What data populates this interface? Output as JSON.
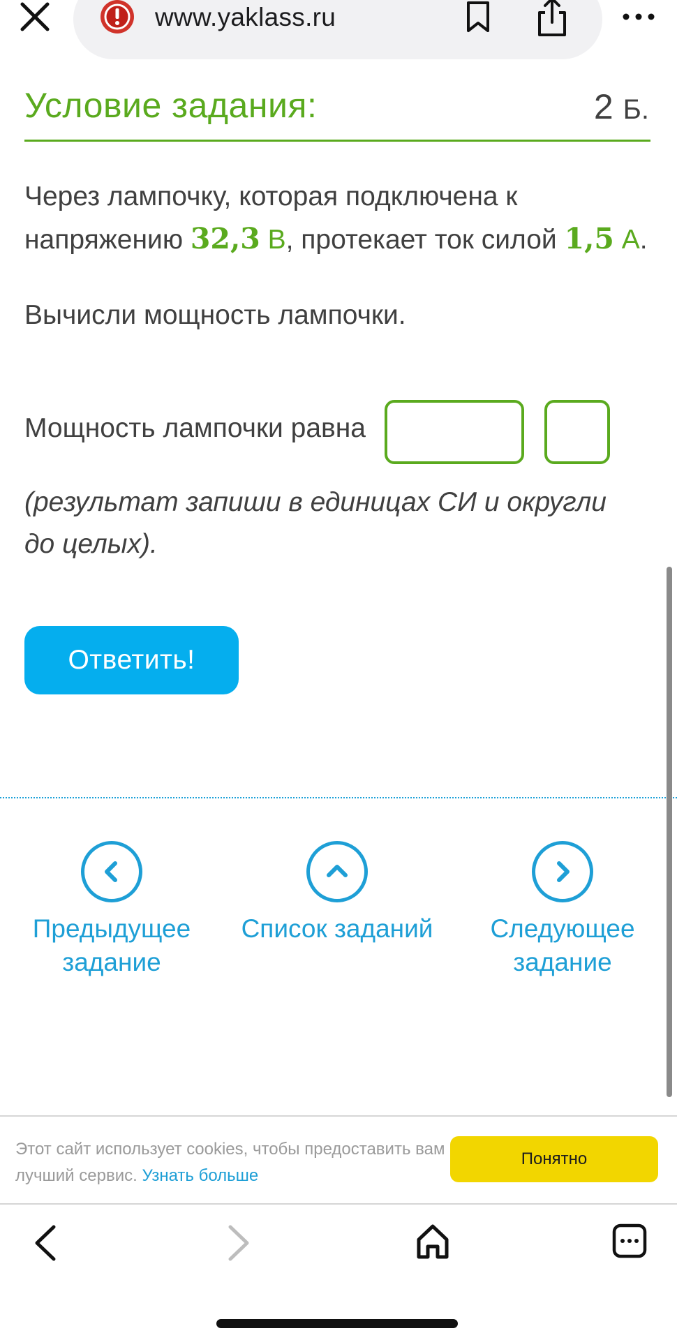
{
  "browser": {
    "url": "www.yaklass.ru"
  },
  "task": {
    "title": "Условие задания:",
    "points_value": "2",
    "points_unit": "Б.",
    "line1": "Через лампочку, которая подключена к",
    "line2_a": "напряжению ",
    "voltage": "32,3",
    "voltage_unit": " В",
    "line2_b": ", протекает ток силой ",
    "current": "1,5",
    "current_unit": " А",
    "line2_c": ".",
    "question": "Вычисли мощность лампочки.",
    "answer_label": "Мощность лампочки равна",
    "answer_value": "",
    "unit_value": "",
    "hint": " (результат запиши в единицах СИ и округли до целых).",
    "submit_label": "Ответить!"
  },
  "nav": {
    "prev_label_1": "Предыдущее",
    "prev_label_2": "задание",
    "list_label": "Список заданий",
    "next_label_1": "Следующее",
    "next_label_2": "задание"
  },
  "cookie": {
    "text": "Этот сайт использует cookies, чтобы предоставить вам лучший сервис. ",
    "link": "Узнать больше",
    "button": "Понятно"
  },
  "colors": {
    "accent_green": "#5aaa1e",
    "link_blue": "#1e9fd6",
    "button_blue": "#05aeee",
    "cookie_yellow": "#f2d600"
  },
  "icons": [
    "close-icon",
    "warning-icon",
    "bookmark-icon",
    "share-icon",
    "more-icon",
    "chevron-left-icon",
    "chevron-up-icon",
    "chevron-right-icon",
    "back-icon",
    "forward-icon",
    "home-icon",
    "tabs-icon"
  ]
}
